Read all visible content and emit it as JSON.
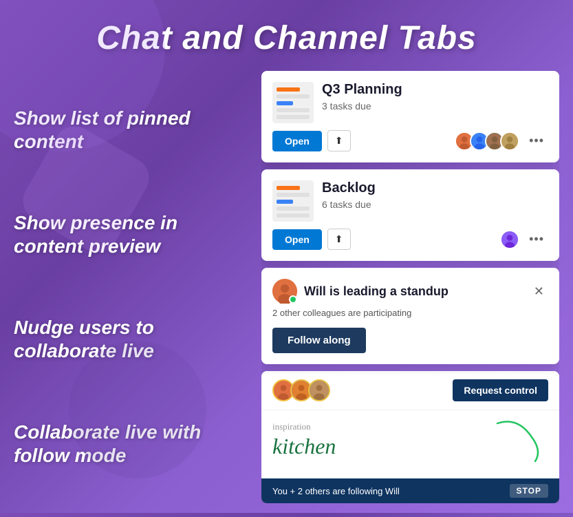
{
  "page": {
    "title": "Chat and Channel Tabs",
    "bg_gradient_start": "#7c4db5",
    "bg_gradient_end": "#9b6de0"
  },
  "features": [
    {
      "id": "pinned",
      "label": "Show list of pinned content"
    },
    {
      "id": "presence",
      "label": "Show presence in content preview"
    },
    {
      "id": "nudge",
      "label": "Nudge users to collaborate live"
    },
    {
      "id": "follow",
      "label": "Collaborate live with follow mode"
    }
  ],
  "cards": {
    "q3": {
      "title": "Q3 Planning",
      "subtitle": "3 tasks due",
      "open_label": "Open",
      "avatars": [
        "A",
        "B",
        "C",
        "D"
      ]
    },
    "backlog": {
      "title": "Backlog",
      "subtitle": "6 tasks due",
      "open_label": "Open",
      "avatars": [
        "E"
      ]
    },
    "standup": {
      "title": "Will is leading a standup",
      "description": "2 other colleagues are participating",
      "follow_label": "Follow along"
    },
    "collab": {
      "request_label": "Request control",
      "content_word1": "inspiration",
      "content_word2": "kitchen",
      "following_text": "You + 2 others are following Will",
      "stop_label": "STOP"
    }
  }
}
